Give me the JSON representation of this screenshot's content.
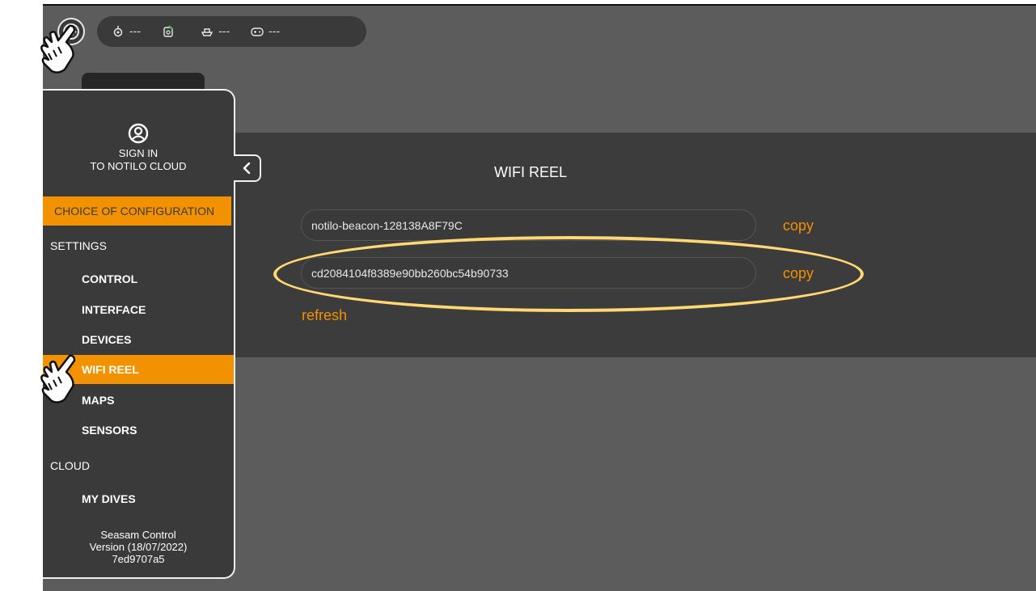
{
  "topbar": {
    "status": [
      {
        "icon": "locator-icon",
        "value": "---"
      },
      {
        "icon": "battery-icon",
        "value": ""
      },
      {
        "icon": "boat-icon",
        "value": "---"
      },
      {
        "icon": "gamepad-icon",
        "value": "---"
      }
    ]
  },
  "sidebar": {
    "signin_line1": "SIGN IN",
    "signin_line2": "TO NOTILO CLOUD",
    "choice_config": "CHOICE OF CONFIGURATION",
    "settings_label": "SETTINGS",
    "settings_items": [
      "CONTROL",
      "INTERFACE",
      "DEVICES",
      "WIFI REEL",
      "MAPS",
      "SENSORS"
    ],
    "active_item": "WIFI REEL",
    "cloud_label": "CLOUD",
    "cloud_items": [
      "MY DIVES"
    ],
    "version_line1": "Seasam Control",
    "version_line2": "Version (18/07/2022)",
    "version_line3": "7ed9707a5"
  },
  "main": {
    "title": "WIFI REEL",
    "ssid": "notilo-beacon-128138A8F79C",
    "password": "cd2084104f8389e90bb260bc54b90733",
    "copy_label": "copy",
    "refresh_label": "refresh"
  },
  "colors": {
    "accent": "#f39200",
    "highlight": "#ffd873",
    "panel": "#3a3a3a"
  }
}
